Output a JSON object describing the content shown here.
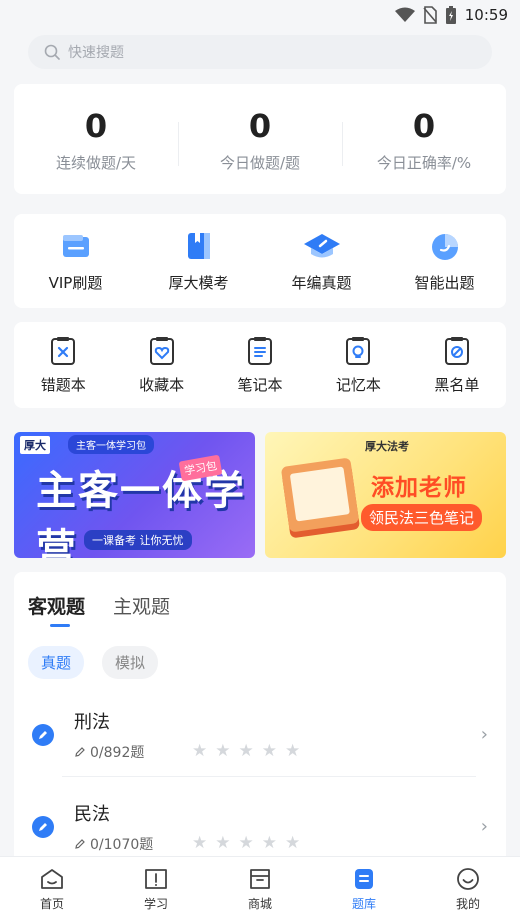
{
  "status_bar": {
    "time": "10:59"
  },
  "search": {
    "placeholder": "快速搜题"
  },
  "stats": [
    {
      "value": "0",
      "label": "连续做题/天"
    },
    {
      "value": "0",
      "label": "今日做题/题"
    },
    {
      "value": "0",
      "label": "今日正确率/%"
    }
  ],
  "features": [
    {
      "label": "VIP刷题",
      "icon": "vip-card-icon"
    },
    {
      "label": "厚大模考",
      "icon": "book-icon"
    },
    {
      "label": "年编真题",
      "icon": "graduation-cap-icon"
    },
    {
      "label": "智能出题",
      "icon": "pie-chart-icon"
    }
  ],
  "tools": [
    {
      "label": "错题本",
      "icon": "wrong-notebook-icon"
    },
    {
      "label": "收藏本",
      "icon": "favorite-notebook-icon"
    },
    {
      "label": "笔记本",
      "icon": "notes-icon"
    },
    {
      "label": "记忆本",
      "icon": "memory-bulb-icon"
    },
    {
      "label": "黑名单",
      "icon": "blacklist-icon"
    }
  ],
  "banners": {
    "left": {
      "brand": "厚大",
      "tag": "主客一体学习包",
      "title": "主客一体学营",
      "badge": "学习包",
      "bottom": "一课备考 让你无忧"
    },
    "right": {
      "brand": "厚大法考",
      "title": "添加老师",
      "subtitle": "领民法三色笔记"
    }
  },
  "question_bank": {
    "tabs": [
      "客观题",
      "主观题"
    ],
    "active_tab": 0,
    "chips": [
      "真题",
      "模拟"
    ],
    "active_chip": 0,
    "subjects": [
      {
        "name": "刑法",
        "progress": "0/892题",
        "stars": 0
      },
      {
        "name": "民法",
        "progress": "0/1070题",
        "stars": 0
      }
    ]
  },
  "bottom_nav": [
    {
      "label": "首页",
      "icon": "home-icon"
    },
    {
      "label": "学习",
      "icon": "study-book-icon"
    },
    {
      "label": "商城",
      "icon": "shop-icon"
    },
    {
      "label": "题库",
      "icon": "question-bank-icon"
    },
    {
      "label": "我的",
      "icon": "profile-smile-icon"
    }
  ],
  "active_nav": 3,
  "colors": {
    "accent": "#2f7cf6",
    "background": "#f5f6f8"
  }
}
